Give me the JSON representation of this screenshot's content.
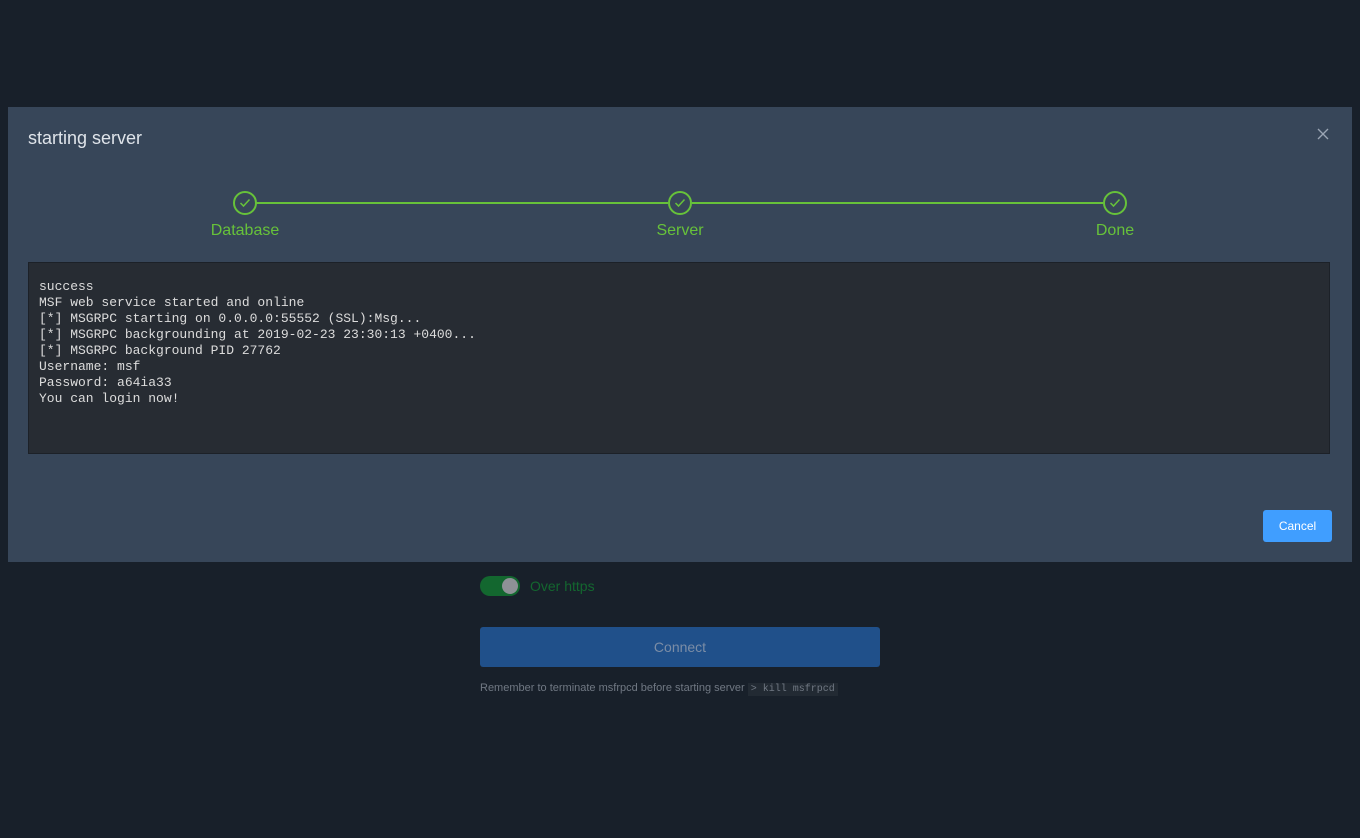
{
  "background_form": {
    "https_toggle_label": "Over https",
    "https_toggle_on": true,
    "connect_label": "Connect",
    "hint_text": "Remember to terminate msfrpcd before starting server",
    "hint_command": "> kill msfrpcd"
  },
  "modal": {
    "title": "starting server",
    "close_icon": "close-icon",
    "steps": [
      {
        "label": "Database",
        "status": "done"
      },
      {
        "label": "Server",
        "status": "done"
      },
      {
        "label": "Done",
        "status": "done"
      }
    ],
    "console_lines": [
      "success",
      "MSF web service started and online",
      "[*] MSGRPC starting on 0.0.0.0:55552 (SSL):Msg...",
      "[*] MSGRPC backgrounding at 2019-02-23 23:30:13 +0400...",
      "[*] MSGRPC background PID 27762",
      "Username: msf",
      "Password: a64ia33",
      "You can login now!"
    ],
    "cancel_label": "Cancel"
  },
  "colors": {
    "page_background": "#18202a",
    "modal_background": "#374659",
    "success": "#67c23a",
    "primary": "#409eff",
    "console_background": "#272c33"
  }
}
